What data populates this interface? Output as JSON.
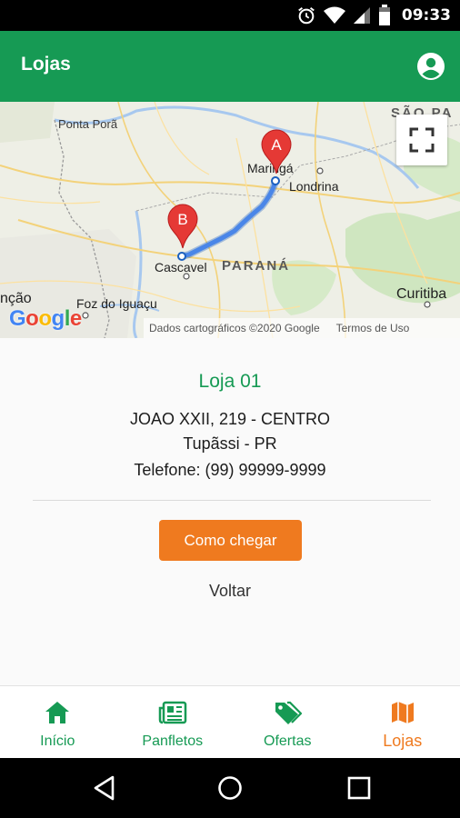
{
  "status_bar": {
    "time": "09:33",
    "icons": [
      "alarm-icon",
      "wifi-icon",
      "signal-icon",
      "battery-icon"
    ]
  },
  "app_bar": {
    "title": "Lojas",
    "account_icon": "account-circle-icon"
  },
  "map": {
    "places": {
      "ponta_pora": "Ponta Porã",
      "sao_paulo": "SÃO PA",
      "maringa": "Maringá",
      "londrina": "Londrina",
      "cascavel": "Cascavel",
      "parana": "PARANÁ",
      "foz": "Foz do Iguaçu",
      "assuncao": "nção",
      "curitiba": "Curitiba"
    },
    "marker_a": "A",
    "marker_b": "B",
    "logo": "Google",
    "attribution": "Dados cartográficos ©2020 Google",
    "terms": "Termos de Uso",
    "fullscreen_icon": "fullscreen-icon"
  },
  "store": {
    "name": "Loja 01",
    "address_line1": "JOAO XXII, 219 - CENTRO",
    "address_line2": "Tupãssi - PR",
    "phone": "Telefone: (99) 99999-9999",
    "route_button": "Como chegar",
    "back_link": "Voltar"
  },
  "bottom_nav": {
    "items": [
      {
        "label": "Início",
        "icon": "home-icon",
        "active": false
      },
      {
        "label": "Panfletos",
        "icon": "newspaper-icon",
        "active": false
      },
      {
        "label": "Ofertas",
        "icon": "tags-icon",
        "active": false
      },
      {
        "label": "Lojas",
        "icon": "map-icon",
        "active": true
      }
    ]
  },
  "colors": {
    "primary": "#169a54",
    "accent": "#ef7a1f",
    "route": "#4a86e8",
    "marker": "#e53935"
  }
}
